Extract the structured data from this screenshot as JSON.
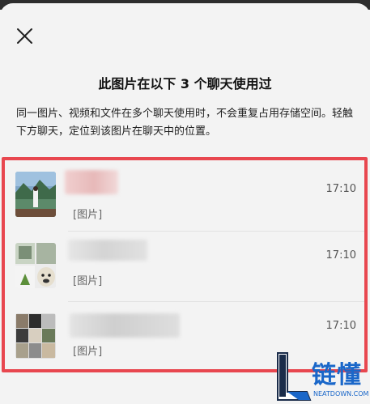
{
  "header": {
    "close_icon": "close-icon",
    "title": "此图片在以下 3 个聊天使用过",
    "description": "同一图片、视频和文件在多个聊天使用时，不会重复占用存储空间。轻触下方聊天，定位到该图片在聊天中的位置。"
  },
  "chats": [
    {
      "time": "17:10",
      "preview": "[图片]"
    },
    {
      "time": "17:10",
      "preview": "[图片]"
    },
    {
      "time": "17:10",
      "preview": "[图片]"
    }
  ],
  "watermark": {
    "name": "链懂",
    "url": "NEATDOWN.COM"
  },
  "colors": {
    "highlight_border": "#e8474f",
    "watermark_blue": "#1a67c9"
  }
}
